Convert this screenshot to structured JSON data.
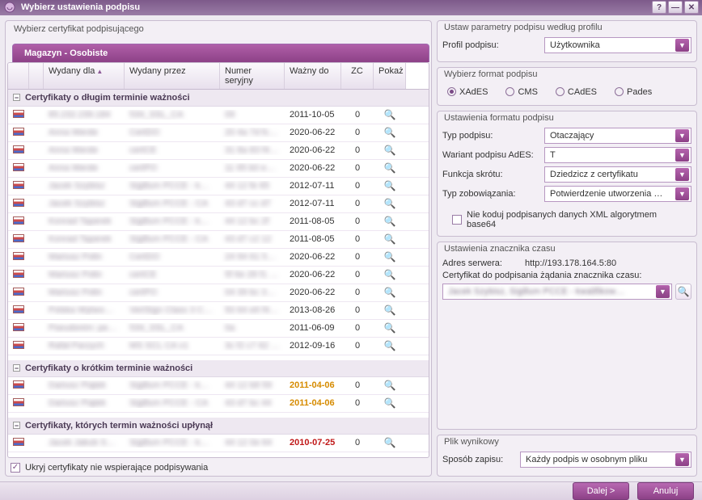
{
  "window": {
    "title": "Wybierz ustawienia podpisu"
  },
  "left": {
    "legend": "Wybierz certyfikat podpisującego",
    "tab": "Magazyn - Osobiste",
    "columns": {
      "issued_to": "Wydany dla",
      "issued_by": "Wydany przez",
      "serial": "Numer seryjny",
      "valid_to": "Ważny do",
      "zc": "ZC",
      "show": "Pokaż"
    },
    "groups": [
      {
        "title": "Certyfikaty o długim terminie ważności",
        "rows": [
          {
            "to": "85.232.239.184",
            "by": "534_SSL_CA",
            "sn": "09",
            "valid": "2011-10-05",
            "zc": "0"
          },
          {
            "to": "Anna Werde",
            "by": "CertDO",
            "sn": "20 4a 7d fc 0…",
            "valid": "2020-06-22",
            "zc": "0"
          },
          {
            "to": "Anna Werde",
            "by": "certCE",
            "sn": "31 8a 83 f4 b…",
            "valid": "2020-06-22",
            "zc": "0"
          },
          {
            "to": "Anna Werde",
            "by": "certPO",
            "sn": "11 95 b0 e4 e…",
            "valid": "2020-06-22",
            "zc": "0"
          },
          {
            "to": "Jacek Szybisz",
            "by": "Sigillum PCCE - kwalif…",
            "sn": "44 12 fe 65",
            "valid": "2012-07-11",
            "zc": "0"
          },
          {
            "to": "Jacek Szybisz",
            "by": "Sigillum PCCE - CA",
            "sn": "43 d7 cc d7",
            "valid": "2012-07-11",
            "zc": "0"
          },
          {
            "to": "Konrad Taperek",
            "by": "Sigillum PCCE - kwalif…",
            "sn": "44 12 bc 2f",
            "valid": "2011-08-05",
            "zc": "0"
          },
          {
            "to": "Konrad Taperek",
            "by": "Sigillum PCCE - CA",
            "sn": "43 d7 c2 12",
            "valid": "2011-08-05",
            "zc": "0"
          },
          {
            "to": "Mariusz Polin",
            "by": "CertDO",
            "sn": "24 94 61 59 7…",
            "valid": "2020-06-22",
            "zc": "0"
          },
          {
            "to": "Mariusz Polin",
            "by": "certCE",
            "sn": "5f 6e 28 f1 9f…",
            "valid": "2020-06-22",
            "zc": "0"
          },
          {
            "to": "Mariusz Polin",
            "by": "certPO",
            "sn": "04 39 bc 3a 8…",
            "valid": "2020-06-22",
            "zc": "0"
          },
          {
            "to": "Polska Wytwo…",
            "by": "VeriSign Class 3 Cod…",
            "sn": "50 64 e6 f4 7…",
            "valid": "2013-08-26",
            "zc": "0"
          },
          {
            "to": "Pseudonim: pe…",
            "by": "534_SSL_CA",
            "sn": "0a",
            "valid": "2011-06-09",
            "zc": "0"
          },
          {
            "to": "Rafał Parzych",
            "by": "MS SCL CA v1",
            "sn": "3c f2 c7 62 9…",
            "valid": "2012-09-16",
            "zc": "0"
          }
        ]
      },
      {
        "title": "Certyfikaty o krótkim terminie ważności",
        "style": "warning",
        "rows": [
          {
            "to": "Dariusz Piątek",
            "by": "Sigillum PCCE - kwalif…",
            "sn": "44 12 b8 59",
            "valid": "2011-04-06",
            "zc": "0"
          },
          {
            "to": "Dariusz Piątek",
            "by": "Sigillum PCCE - CA",
            "sn": "43 d7 bc 44",
            "valid": "2011-04-06",
            "zc": "0"
          }
        ]
      },
      {
        "title": "Certyfikaty, których termin ważności upłynął",
        "style": "expired",
        "rows": [
          {
            "to": "Jacek Jakub S…",
            "by": "Sigillum PCCE - kwalif…",
            "sn": "44 12 0e 64",
            "valid": "2010-07-25",
            "zc": "0"
          }
        ]
      }
    ],
    "hide_unsupported": "Ukryj certyfikaty nie wspierające podpisywania"
  },
  "right": {
    "profile": {
      "legend": "Ustaw parametry podpisu według profilu",
      "label": "Profil podpisu:",
      "value": "Użytkownika"
    },
    "format": {
      "legend": "Wybierz format podpisu",
      "options": [
        "XAdES",
        "CMS",
        "CAdES",
        "Pades"
      ],
      "selected": "XAdES"
    },
    "format_settings": {
      "legend": "Ustawienia formatu podpisu",
      "type_label": "Typ podpisu:",
      "type_value": "Otaczający",
      "variant_label": "Wariant podpisu AdES:",
      "variant_value": "T",
      "hash_label": "Funkcja skrótu:",
      "hash_value": "Dziedzicz z certyfikatu",
      "commitment_label": "Typ zobowiązania:",
      "commitment_value": "Potwierdzenie utworzenia  …",
      "b64_label": "Nie koduj podpisanych danych XML algorytmem base64"
    },
    "timestamp": {
      "legend": "Ustawienia znacznika czasu",
      "server_label": "Adres serwera:",
      "server_value": "http://193.178.164.5:80",
      "cert_label": "Certyfikat do podpisania żądania znacznika czasu:",
      "cert_value": "Jacek Szybisz,  Sigillum PCCE - kwalifikow…"
    },
    "output": {
      "legend": "Plik wynikowy",
      "label": "Sposób zapisu:",
      "value": "Każdy podpis w osobnym pliku"
    }
  },
  "footer": {
    "next": "Dalej >",
    "cancel": "Anuluj"
  }
}
